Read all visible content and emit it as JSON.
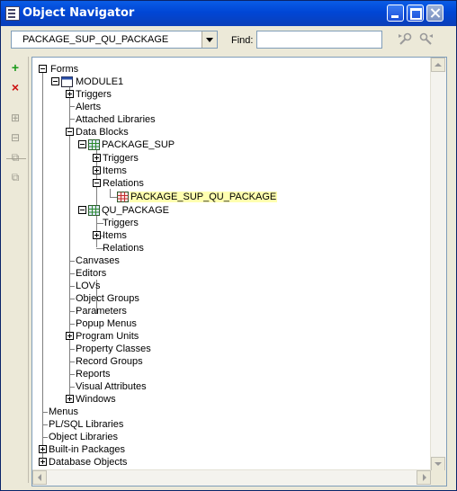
{
  "window": {
    "title": "Object Navigator"
  },
  "toolbar": {
    "context_value": "PACKAGE_SUP_QU_PACKAGE",
    "find_label": "Find:",
    "find_value": ""
  },
  "tree": {
    "forms": "Forms",
    "module": "MODULE1",
    "triggers": "Triggers",
    "alerts": "Alerts",
    "attached_libraries": "Attached Libraries",
    "data_blocks": "Data Blocks",
    "package_sup": "PACKAGE_SUP",
    "ps_triggers": "Triggers",
    "ps_items": "Items",
    "ps_relations": "Relations",
    "relation": "PACKAGE_SUP_QU_PACKAGE",
    "qu_package": "QU_PACKAGE",
    "qu_triggers": "Triggers",
    "qu_items": "Items",
    "qu_relations": "Relations",
    "canvases": "Canvases",
    "editors": "Editors",
    "lovs": "LOVs",
    "object_groups": "Object Groups",
    "parameters": "Parameters",
    "popup_menus": "Popup Menus",
    "program_units": "Program Units",
    "property_classes": "Property Classes",
    "record_groups": "Record Groups",
    "reports": "Reports",
    "visual_attributes": "Visual Attributes",
    "windows": "Windows",
    "menus": "Menus",
    "plsql_libraries": "PL/SQL Libraries",
    "object_libraries": "Object Libraries",
    "builtin_packages": "Built-in Packages",
    "database_objects": "Database Objects"
  }
}
